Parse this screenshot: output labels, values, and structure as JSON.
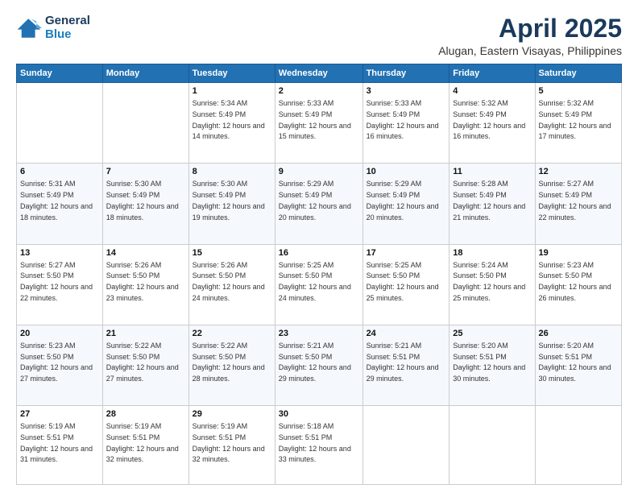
{
  "header": {
    "logo_line1": "General",
    "logo_line2": "Blue",
    "title": "April 2025",
    "subtitle": "Alugan, Eastern Visayas, Philippines"
  },
  "weekdays": [
    "Sunday",
    "Monday",
    "Tuesday",
    "Wednesday",
    "Thursday",
    "Friday",
    "Saturday"
  ],
  "weeks": [
    [
      {
        "day": "",
        "info": ""
      },
      {
        "day": "",
        "info": ""
      },
      {
        "day": "1",
        "info": "Sunrise: 5:34 AM\nSunset: 5:49 PM\nDaylight: 12 hours and 14 minutes."
      },
      {
        "day": "2",
        "info": "Sunrise: 5:33 AM\nSunset: 5:49 PM\nDaylight: 12 hours and 15 minutes."
      },
      {
        "day": "3",
        "info": "Sunrise: 5:33 AM\nSunset: 5:49 PM\nDaylight: 12 hours and 16 minutes."
      },
      {
        "day": "4",
        "info": "Sunrise: 5:32 AM\nSunset: 5:49 PM\nDaylight: 12 hours and 16 minutes."
      },
      {
        "day": "5",
        "info": "Sunrise: 5:32 AM\nSunset: 5:49 PM\nDaylight: 12 hours and 17 minutes."
      }
    ],
    [
      {
        "day": "6",
        "info": "Sunrise: 5:31 AM\nSunset: 5:49 PM\nDaylight: 12 hours and 18 minutes."
      },
      {
        "day": "7",
        "info": "Sunrise: 5:30 AM\nSunset: 5:49 PM\nDaylight: 12 hours and 18 minutes."
      },
      {
        "day": "8",
        "info": "Sunrise: 5:30 AM\nSunset: 5:49 PM\nDaylight: 12 hours and 19 minutes."
      },
      {
        "day": "9",
        "info": "Sunrise: 5:29 AM\nSunset: 5:49 PM\nDaylight: 12 hours and 20 minutes."
      },
      {
        "day": "10",
        "info": "Sunrise: 5:29 AM\nSunset: 5:49 PM\nDaylight: 12 hours and 20 minutes."
      },
      {
        "day": "11",
        "info": "Sunrise: 5:28 AM\nSunset: 5:49 PM\nDaylight: 12 hours and 21 minutes."
      },
      {
        "day": "12",
        "info": "Sunrise: 5:27 AM\nSunset: 5:49 PM\nDaylight: 12 hours and 22 minutes."
      }
    ],
    [
      {
        "day": "13",
        "info": "Sunrise: 5:27 AM\nSunset: 5:50 PM\nDaylight: 12 hours and 22 minutes."
      },
      {
        "day": "14",
        "info": "Sunrise: 5:26 AM\nSunset: 5:50 PM\nDaylight: 12 hours and 23 minutes."
      },
      {
        "day": "15",
        "info": "Sunrise: 5:26 AM\nSunset: 5:50 PM\nDaylight: 12 hours and 24 minutes."
      },
      {
        "day": "16",
        "info": "Sunrise: 5:25 AM\nSunset: 5:50 PM\nDaylight: 12 hours and 24 minutes."
      },
      {
        "day": "17",
        "info": "Sunrise: 5:25 AM\nSunset: 5:50 PM\nDaylight: 12 hours and 25 minutes."
      },
      {
        "day": "18",
        "info": "Sunrise: 5:24 AM\nSunset: 5:50 PM\nDaylight: 12 hours and 25 minutes."
      },
      {
        "day": "19",
        "info": "Sunrise: 5:23 AM\nSunset: 5:50 PM\nDaylight: 12 hours and 26 minutes."
      }
    ],
    [
      {
        "day": "20",
        "info": "Sunrise: 5:23 AM\nSunset: 5:50 PM\nDaylight: 12 hours and 27 minutes."
      },
      {
        "day": "21",
        "info": "Sunrise: 5:22 AM\nSunset: 5:50 PM\nDaylight: 12 hours and 27 minutes."
      },
      {
        "day": "22",
        "info": "Sunrise: 5:22 AM\nSunset: 5:50 PM\nDaylight: 12 hours and 28 minutes."
      },
      {
        "day": "23",
        "info": "Sunrise: 5:21 AM\nSunset: 5:50 PM\nDaylight: 12 hours and 29 minutes."
      },
      {
        "day": "24",
        "info": "Sunrise: 5:21 AM\nSunset: 5:51 PM\nDaylight: 12 hours and 29 minutes."
      },
      {
        "day": "25",
        "info": "Sunrise: 5:20 AM\nSunset: 5:51 PM\nDaylight: 12 hours and 30 minutes."
      },
      {
        "day": "26",
        "info": "Sunrise: 5:20 AM\nSunset: 5:51 PM\nDaylight: 12 hours and 30 minutes."
      }
    ],
    [
      {
        "day": "27",
        "info": "Sunrise: 5:19 AM\nSunset: 5:51 PM\nDaylight: 12 hours and 31 minutes."
      },
      {
        "day": "28",
        "info": "Sunrise: 5:19 AM\nSunset: 5:51 PM\nDaylight: 12 hours and 32 minutes."
      },
      {
        "day": "29",
        "info": "Sunrise: 5:19 AM\nSunset: 5:51 PM\nDaylight: 12 hours and 32 minutes."
      },
      {
        "day": "30",
        "info": "Sunrise: 5:18 AM\nSunset: 5:51 PM\nDaylight: 12 hours and 33 minutes."
      },
      {
        "day": "",
        "info": ""
      },
      {
        "day": "",
        "info": ""
      },
      {
        "day": "",
        "info": ""
      }
    ]
  ]
}
